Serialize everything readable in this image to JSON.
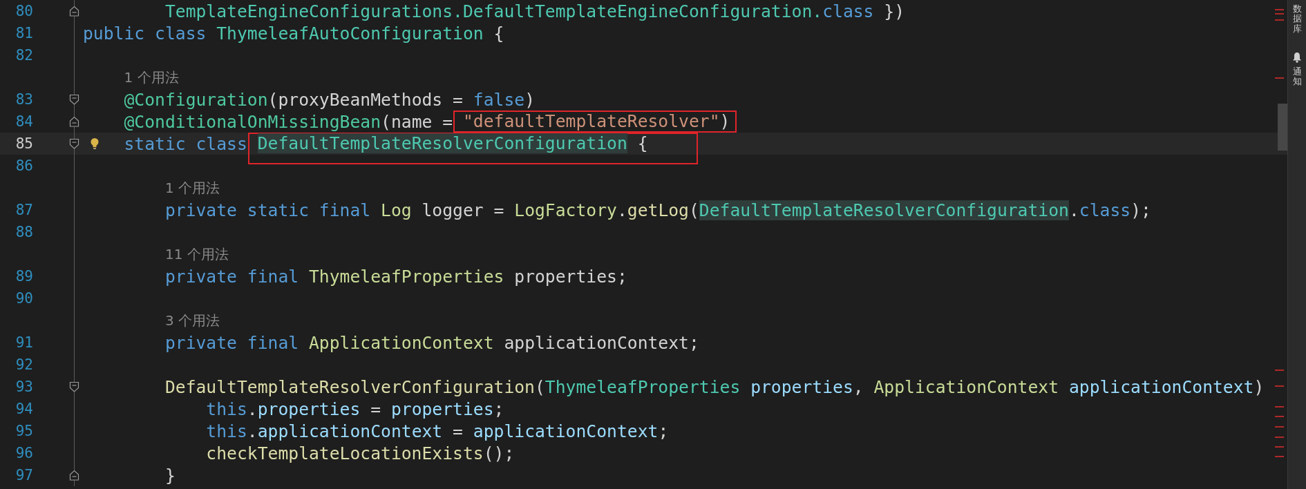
{
  "editor": {
    "lines": [
      {
        "kind": "code",
        "number": "80",
        "current": false,
        "fold_end": true,
        "tokens": [
          {
            "text": "        TemplateEngineConfigurations.DefaultTemplateEngineConfiguration.",
            "kind": "class"
          },
          {
            "text": "class",
            "kind": "keyword"
          },
          {
            "text": " })",
            "kind": "plain"
          }
        ]
      },
      {
        "kind": "code",
        "number": "81",
        "current": false,
        "tokens": [
          {
            "text": "public ",
            "kind": "keyword"
          },
          {
            "text": "class ",
            "kind": "keyword"
          },
          {
            "text": "ThymeleafAutoConfiguration",
            "kind": "class"
          },
          {
            "text": " {",
            "kind": "plain"
          }
        ]
      },
      {
        "kind": "code",
        "number": "82",
        "current": false
      },
      {
        "kind": "hint",
        "text": "    1 个用法"
      },
      {
        "kind": "code",
        "number": "83",
        "current": false,
        "fold_start": true,
        "tokens": [
          {
            "text": "    @Configuration",
            "kind": "annotation"
          },
          {
            "text": "(proxyBeanMethods = ",
            "kind": "plain"
          },
          {
            "text": "false",
            "kind": "keyword"
          },
          {
            "text": ")",
            "kind": "plain"
          }
        ]
      },
      {
        "kind": "code",
        "number": "84",
        "current": false,
        "fold_end": true,
        "tokens": [
          {
            "text": "    @ConditionalOnMissingBean",
            "kind": "annotation"
          },
          {
            "text": "(name = ",
            "kind": "plain"
          },
          {
            "text": "\"defaultTemplateResolver\"",
            "kind": "string",
            "boxed": true
          },
          {
            "text": ")",
            "kind": "plain",
            "boxed": true
          }
        ]
      },
      {
        "kind": "code",
        "number": "85",
        "current": true,
        "fold_start": true,
        "bulb": true,
        "tokens": [
          {
            "text": "    static ",
            "kind": "keyword"
          },
          {
            "text": "class ",
            "kind": "keyword"
          },
          {
            "text": "DefaultTemplateResolverConfiguration",
            "kind": "class",
            "highlighted": true,
            "boxed": true
          },
          {
            "text": " {",
            "kind": "plain",
            "boxed": true
          }
        ]
      },
      {
        "kind": "code",
        "number": "86",
        "current": false
      },
      {
        "kind": "hint",
        "text": "        1 个用法"
      },
      {
        "kind": "code",
        "number": "87",
        "current": false,
        "tokens": [
          {
            "text": "        private static final ",
            "kind": "keyword"
          },
          {
            "text": "Log",
            "kind": "type"
          },
          {
            "text": " logger = ",
            "kind": "plain"
          },
          {
            "text": "LogFactory",
            "kind": "type"
          },
          {
            "text": ".",
            "kind": "plain"
          },
          {
            "text": "getLog",
            "kind": "method"
          },
          {
            "text": "(",
            "kind": "plain"
          },
          {
            "text": "DefaultTemplateResolverConfiguration",
            "kind": "class",
            "highlighted": true
          },
          {
            "text": ".",
            "kind": "plain"
          },
          {
            "text": "class",
            "kind": "keyword"
          },
          {
            "text": ");",
            "kind": "plain"
          }
        ]
      },
      {
        "kind": "code",
        "number": "88",
        "current": false
      },
      {
        "kind": "hint",
        "text": "        11 个用法"
      },
      {
        "kind": "code",
        "number": "89",
        "current": false,
        "tokens": [
          {
            "text": "        private final ",
            "kind": "keyword"
          },
          {
            "text": "ThymeleafProperties",
            "kind": "type"
          },
          {
            "text": " properties;",
            "kind": "plain"
          }
        ]
      },
      {
        "kind": "code",
        "number": "90",
        "current": false
      },
      {
        "kind": "hint",
        "text": "        3 个用法"
      },
      {
        "kind": "code",
        "number": "91",
        "current": false,
        "tokens": [
          {
            "text": "        private final ",
            "kind": "keyword"
          },
          {
            "text": "ApplicationContext",
            "kind": "type"
          },
          {
            "text": " applicationContext;",
            "kind": "plain"
          }
        ]
      },
      {
        "kind": "code",
        "number": "92",
        "current": false
      },
      {
        "kind": "code",
        "number": "93",
        "current": false,
        "fold_start": true,
        "tokens": [
          {
            "text": "        DefaultTemplateResolverConfiguration",
            "kind": "method"
          },
          {
            "text": "(",
            "kind": "plain"
          },
          {
            "text": "ThymeleafProperties",
            "kind": "class"
          },
          {
            "text": " properties",
            "kind": "variable"
          },
          {
            "text": ", ",
            "kind": "plain"
          },
          {
            "text": "ApplicationContext",
            "kind": "type"
          },
          {
            "text": " applicationContext",
            "kind": "variable"
          },
          {
            "text": ")",
            "kind": "plain"
          }
        ]
      },
      {
        "kind": "code",
        "number": "94",
        "current": false,
        "tokens": [
          {
            "text": "            this",
            "kind": "keyword"
          },
          {
            "text": ".",
            "kind": "plain"
          },
          {
            "text": "properties",
            "kind": "variable"
          },
          {
            "text": " = ",
            "kind": "plain"
          },
          {
            "text": "properties",
            "kind": "variable"
          },
          {
            "text": ";",
            "kind": "plain"
          }
        ]
      },
      {
        "kind": "code",
        "number": "95",
        "current": false,
        "tokens": [
          {
            "text": "            this",
            "kind": "keyword"
          },
          {
            "text": ".",
            "kind": "plain"
          },
          {
            "text": "applicationContext",
            "kind": "variable"
          },
          {
            "text": " = ",
            "kind": "plain"
          },
          {
            "text": "applicationContext",
            "kind": "variable"
          },
          {
            "text": ";",
            "kind": "plain"
          }
        ]
      },
      {
        "kind": "code",
        "number": "96",
        "current": false,
        "tokens": [
          {
            "text": "            checkTemplateLocationExists",
            "kind": "method"
          },
          {
            "text": "();",
            "kind": "plain"
          }
        ]
      },
      {
        "kind": "code",
        "number": "97",
        "current": false,
        "fold_end": true,
        "tokens": [
          {
            "text": "        }",
            "kind": "plain"
          }
        ]
      }
    ]
  },
  "tool_strip": {
    "items": [
      {
        "label": "数据库",
        "kind": "text"
      },
      {
        "label": "通知",
        "kind": "bell"
      }
    ]
  }
}
